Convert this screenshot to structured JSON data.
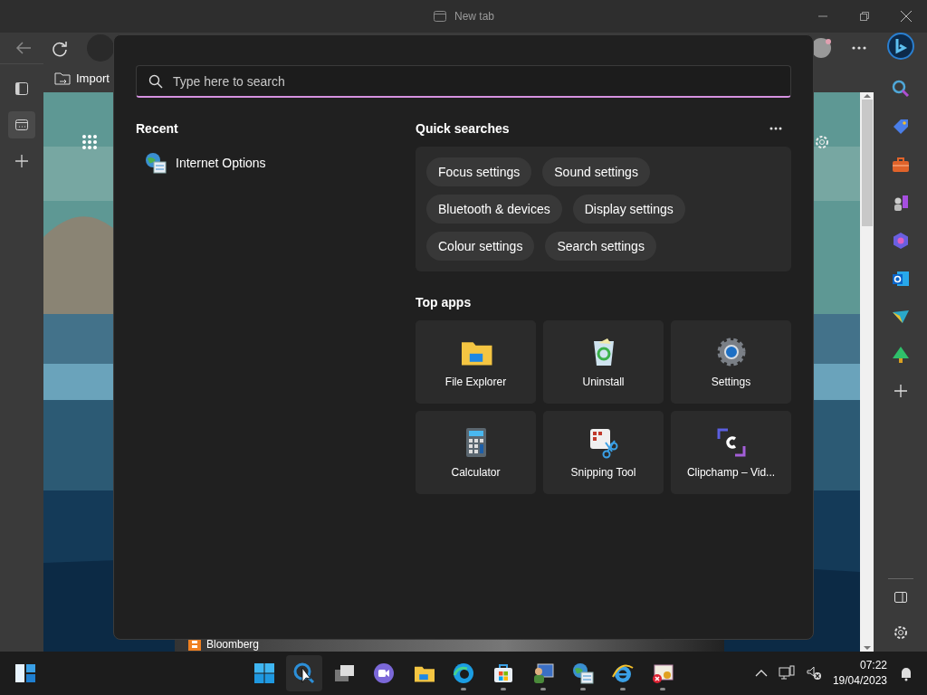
{
  "browser": {
    "title": "New tab",
    "favorites": [
      {
        "label": "Import"
      }
    ],
    "news_tile": {
      "label": "Bloomberg"
    }
  },
  "search_flyout": {
    "search": {
      "placeholder": "Type here to search"
    },
    "recent": {
      "title": "Recent",
      "items": [
        {
          "label": "Internet Options"
        }
      ]
    },
    "quick_searches": {
      "title": "Quick searches",
      "rows": [
        {
          "chips": [
            {
              "label": "Focus settings"
            },
            {
              "label": "Sound settings"
            }
          ]
        },
        {
          "chips": [
            {
              "label": "Bluetooth & devices"
            },
            {
              "label": "Display settings"
            }
          ]
        },
        {
          "chips": [
            {
              "label": "Colour settings"
            },
            {
              "label": "Search settings"
            }
          ]
        }
      ]
    },
    "top_apps": {
      "title": "Top apps",
      "apps": [
        {
          "label": "File Explorer"
        },
        {
          "label": "Uninstall"
        },
        {
          "label": "Settings"
        },
        {
          "label": "Calculator"
        },
        {
          "label": "Snipping Tool"
        },
        {
          "label": "Clipchamp – Vid..."
        }
      ]
    }
  },
  "taskbar": {
    "apps": [
      {
        "selected": false,
        "running": false
      },
      {
        "selected": true,
        "running": false
      },
      {
        "selected": false,
        "running": false
      },
      {
        "selected": false,
        "running": false
      },
      {
        "selected": false,
        "running": false
      },
      {
        "selected": false,
        "running": true
      },
      {
        "selected": false,
        "running": true
      },
      {
        "selected": false,
        "running": true
      },
      {
        "selected": false,
        "running": true
      },
      {
        "selected": false,
        "running": true
      },
      {
        "selected": false,
        "running": true
      }
    ],
    "clock": {
      "time": "07:22",
      "date": "19/04/2023"
    }
  }
}
